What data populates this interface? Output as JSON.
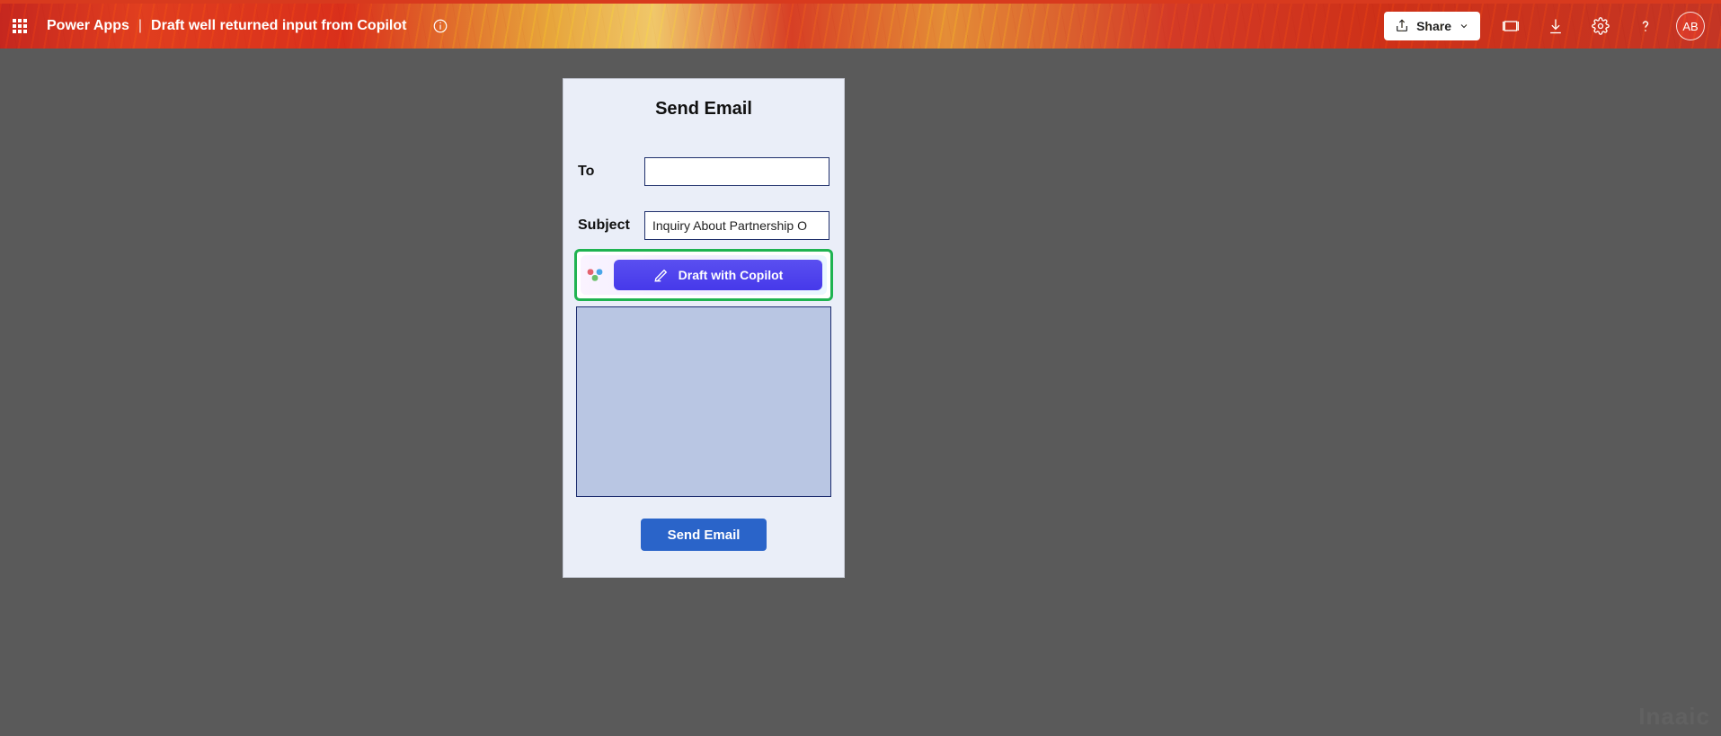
{
  "header": {
    "app_name": "Power Apps",
    "separator": "|",
    "page_title": "Draft well returned input from Copilot",
    "share_label": "Share",
    "avatar_initials": "AB"
  },
  "email_form": {
    "title": "Send Email",
    "to_label": "To",
    "to_value": "",
    "subject_label": "Subject",
    "subject_value": "Inquiry About Partnership O",
    "copilot_button_label": "Draft with Copilot",
    "body_value": "",
    "send_button_label": "Send Email"
  },
  "watermark": "Inaaic",
  "colors": {
    "accent_red": "#d83a1e",
    "copilot_purple": "#4639ea",
    "highlight_green": "#1fb351",
    "send_blue": "#2a64c9",
    "card_bg": "#eaeef8"
  }
}
